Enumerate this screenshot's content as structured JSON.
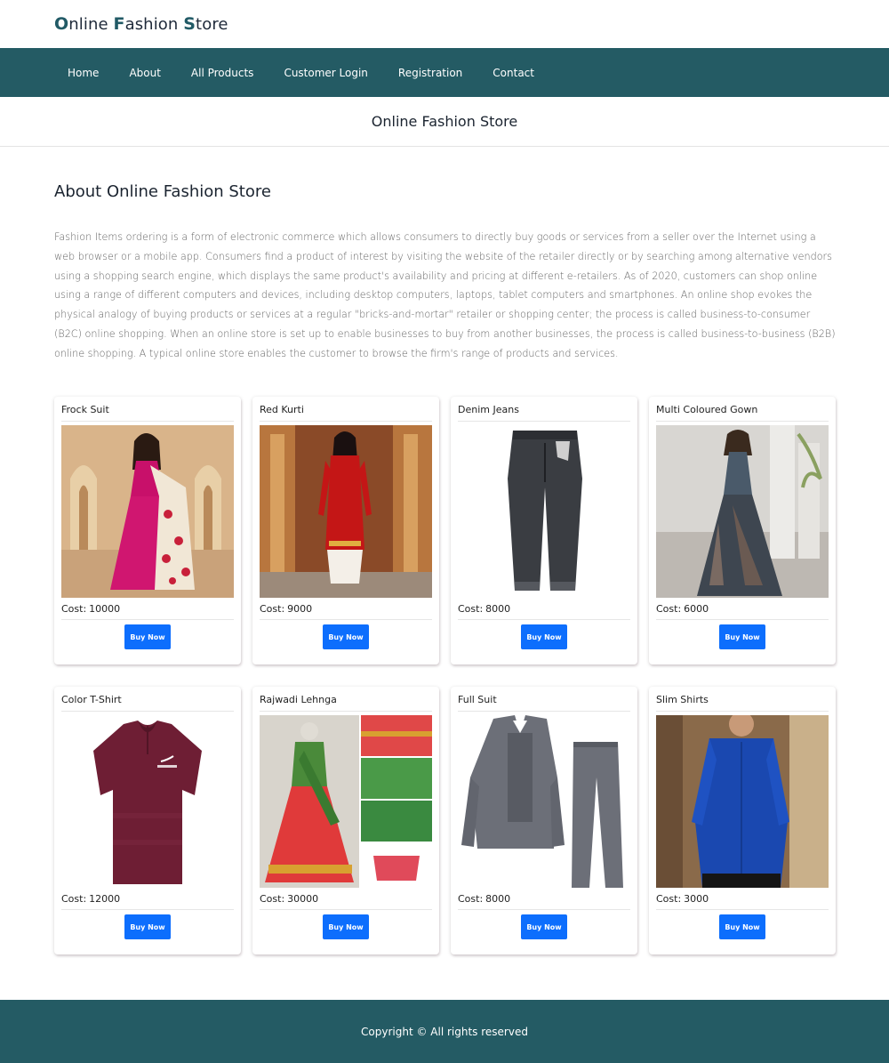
{
  "brand": {
    "c1": "O",
    "r1": "nline ",
    "c2": "F",
    "r2": "ashion ",
    "c3": "S",
    "r3": "tore"
  },
  "nav": [
    "Home",
    "About",
    "All Products",
    "Customer Login",
    "Registration",
    "Contact"
  ],
  "banner_title": "Online Fashion Store",
  "about": {
    "heading": "About Online Fashion Store",
    "text": "Fashion Items ordering is a form of electronic commerce which allows consumers to directly buy goods or services from a seller over the Internet using a web browser or a mobile app. Consumers find a product of interest by visiting the website of the retailer directly or by searching among alternative vendors using a shopping search engine, which displays the same product's availability and pricing at different e-retailers. As of 2020, customers can shop online using a range of different computers and devices, including desktop computers, laptops, tablet computers and smartphones. An online shop evokes the physical analogy of buying products or services at a regular \"bricks-and-mortar\" retailer or shopping center; the process is called business-to-consumer (B2C) online shopping. When an online store is set up to enable businesses to buy from another businesses, the process is called business-to-business (B2B) online shopping. A typical online store enables the customer to browse the firm's range of products and services."
  },
  "cost_label": "Cost:",
  "buy_label": "Buy Now",
  "products": [
    {
      "name": "Frock Suit",
      "cost": "10000",
      "image": "pink-floral-gown-photo"
    },
    {
      "name": "Red Kurti",
      "cost": "9000",
      "image": "red-kurti-photo"
    },
    {
      "name": "Denim Jeans",
      "cost": "8000",
      "image": "dark-jeans-photo"
    },
    {
      "name": "Multi Coloured Gown",
      "cost": "6000",
      "image": "dark-gown-photo"
    },
    {
      "name": "Color T-Shirt",
      "cost": "12000",
      "image": "maroon-polo-photo"
    },
    {
      "name": "Rajwadi Lehnga",
      "cost": "30000",
      "image": "green-red-lehnga-photo"
    },
    {
      "name": "Full Suit",
      "cost": "8000",
      "image": "grey-suit-photo"
    },
    {
      "name": "Slim Shirts",
      "cost": "3000",
      "image": "blue-shirt-photo"
    }
  ],
  "footer": "Copyright © All rights reserved",
  "colors": {
    "nav_bg": "#245b64",
    "button": "#0d6efd",
    "brand_accent": "#215a66"
  }
}
